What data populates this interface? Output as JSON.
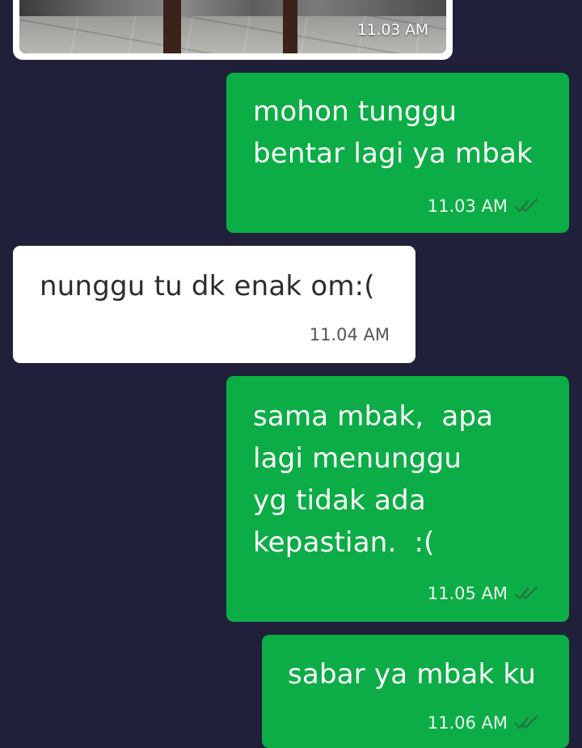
{
  "photo_message": {
    "time": "11.03 AM"
  },
  "messages": [
    {
      "direction": "out",
      "lines": [
        "mohon tunggu",
        "bentar lagi ya mbak"
      ],
      "time": "11.03 AM",
      "status": "read"
    },
    {
      "direction": "in",
      "lines": [
        "nunggu tu dk enak om:("
      ],
      "time": "11.04 AM"
    },
    {
      "direction": "out",
      "lines": [
        "sama mbak,  apa",
        "lagi menunggu",
        "yg tidak ada",
        "kepastian.  :("
      ],
      "time": "11.05 AM",
      "status": "read"
    },
    {
      "direction": "out",
      "lines": [
        "sabar ya mbak ku"
      ],
      "time": "11.06 AM",
      "status": "read"
    }
  ],
  "colors": {
    "background": "#20203a",
    "outgoing_bubble": "#0cad46",
    "incoming_bubble": "#ffffff",
    "read_check": "#1f7a3f"
  },
  "icons": {
    "read_status": "double-check-icon"
  }
}
